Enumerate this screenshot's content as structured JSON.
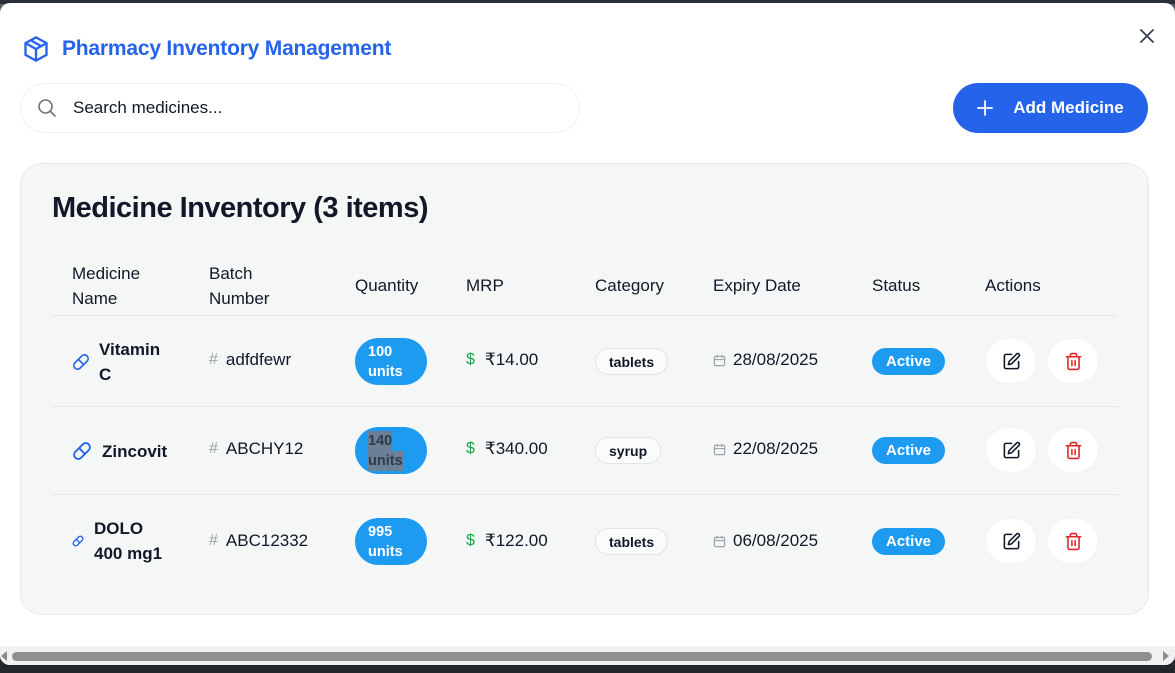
{
  "header": {
    "title": "Pharmacy Inventory Management",
    "icon": "package-icon",
    "close_icon": "close-icon"
  },
  "search": {
    "placeholder": "Search medicines..."
  },
  "add_button": {
    "label": "Add Medicine",
    "icon": "plus-icon"
  },
  "inventory": {
    "title": "Medicine Inventory (3 items)",
    "columns": {
      "name": "Medicine Name",
      "batch": "Batch Number",
      "quantity": "Quantity",
      "mrp": "MRP",
      "category": "Category",
      "expiry": "Expiry Date",
      "status": "Status",
      "actions": "Actions"
    },
    "rows": [
      {
        "name_line1": "Vitamin",
        "name_line2": "C",
        "batch": "adfdfewr",
        "qty_num": "100",
        "qty_unit": "units",
        "mrp": "₹14.00",
        "category": "tablets",
        "expiry": "28/08/2025",
        "status": "Active"
      },
      {
        "name_line1": "Zincovit",
        "name_line2": "",
        "batch": "ABCHY12",
        "qty_num": "140",
        "qty_unit": "units",
        "mrp": "₹340.00",
        "category": "syrup",
        "expiry": "22/08/2025",
        "status": "Active"
      },
      {
        "name_line1": "DOLO",
        "name_line2": "400 mg1",
        "batch": "ABC12332",
        "qty_num": "995",
        "qty_unit": "units",
        "mrp": "₹122.00",
        "category": "tablets",
        "expiry": "06/08/2025",
        "status": "Active"
      }
    ],
    "currency_symbol": "$",
    "batch_symbol": "#"
  },
  "colors": {
    "brand_blue": "#2563eb",
    "pill_blue": "#1d9bf0",
    "delete_red": "#dc2626",
    "money_green": "#16a34a"
  }
}
